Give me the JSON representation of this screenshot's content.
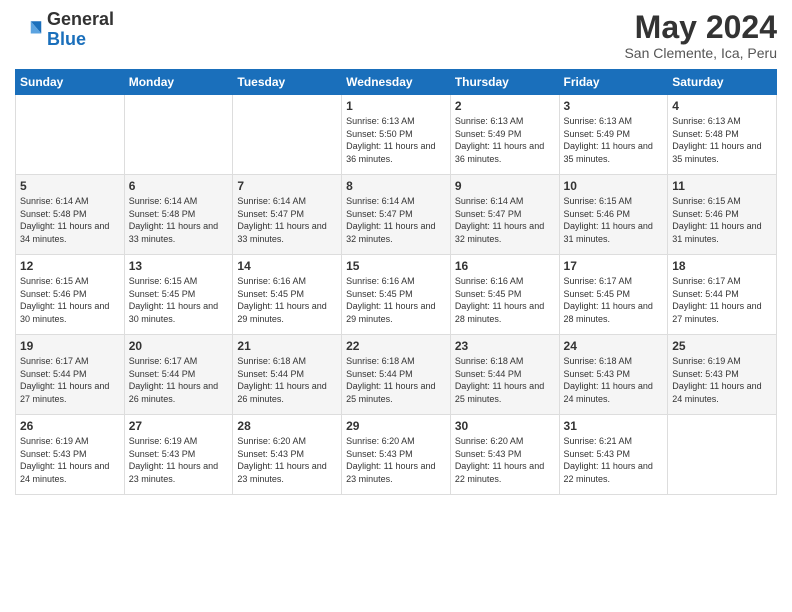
{
  "logo": {
    "general": "General",
    "blue": "Blue"
  },
  "header": {
    "month_title": "May 2024",
    "subtitle": "San Clemente, Ica, Peru"
  },
  "days_of_week": [
    "Sunday",
    "Monday",
    "Tuesday",
    "Wednesday",
    "Thursday",
    "Friday",
    "Saturday"
  ],
  "weeks": [
    [
      {
        "day": "",
        "info": ""
      },
      {
        "day": "",
        "info": ""
      },
      {
        "day": "",
        "info": ""
      },
      {
        "day": "1",
        "info": "Sunrise: 6:13 AM\nSunset: 5:50 PM\nDaylight: 11 hours and 36 minutes."
      },
      {
        "day": "2",
        "info": "Sunrise: 6:13 AM\nSunset: 5:49 PM\nDaylight: 11 hours and 36 minutes."
      },
      {
        "day": "3",
        "info": "Sunrise: 6:13 AM\nSunset: 5:49 PM\nDaylight: 11 hours and 35 minutes."
      },
      {
        "day": "4",
        "info": "Sunrise: 6:13 AM\nSunset: 5:48 PM\nDaylight: 11 hours and 35 minutes."
      }
    ],
    [
      {
        "day": "5",
        "info": "Sunrise: 6:14 AM\nSunset: 5:48 PM\nDaylight: 11 hours and 34 minutes."
      },
      {
        "day": "6",
        "info": "Sunrise: 6:14 AM\nSunset: 5:48 PM\nDaylight: 11 hours and 33 minutes."
      },
      {
        "day": "7",
        "info": "Sunrise: 6:14 AM\nSunset: 5:47 PM\nDaylight: 11 hours and 33 minutes."
      },
      {
        "day": "8",
        "info": "Sunrise: 6:14 AM\nSunset: 5:47 PM\nDaylight: 11 hours and 32 minutes."
      },
      {
        "day": "9",
        "info": "Sunrise: 6:14 AM\nSunset: 5:47 PM\nDaylight: 11 hours and 32 minutes."
      },
      {
        "day": "10",
        "info": "Sunrise: 6:15 AM\nSunset: 5:46 PM\nDaylight: 11 hours and 31 minutes."
      },
      {
        "day": "11",
        "info": "Sunrise: 6:15 AM\nSunset: 5:46 PM\nDaylight: 11 hours and 31 minutes."
      }
    ],
    [
      {
        "day": "12",
        "info": "Sunrise: 6:15 AM\nSunset: 5:46 PM\nDaylight: 11 hours and 30 minutes."
      },
      {
        "day": "13",
        "info": "Sunrise: 6:15 AM\nSunset: 5:45 PM\nDaylight: 11 hours and 30 minutes."
      },
      {
        "day": "14",
        "info": "Sunrise: 6:16 AM\nSunset: 5:45 PM\nDaylight: 11 hours and 29 minutes."
      },
      {
        "day": "15",
        "info": "Sunrise: 6:16 AM\nSunset: 5:45 PM\nDaylight: 11 hours and 29 minutes."
      },
      {
        "day": "16",
        "info": "Sunrise: 6:16 AM\nSunset: 5:45 PM\nDaylight: 11 hours and 28 minutes."
      },
      {
        "day": "17",
        "info": "Sunrise: 6:17 AM\nSunset: 5:45 PM\nDaylight: 11 hours and 28 minutes."
      },
      {
        "day": "18",
        "info": "Sunrise: 6:17 AM\nSunset: 5:44 PM\nDaylight: 11 hours and 27 minutes."
      }
    ],
    [
      {
        "day": "19",
        "info": "Sunrise: 6:17 AM\nSunset: 5:44 PM\nDaylight: 11 hours and 27 minutes."
      },
      {
        "day": "20",
        "info": "Sunrise: 6:17 AM\nSunset: 5:44 PM\nDaylight: 11 hours and 26 minutes."
      },
      {
        "day": "21",
        "info": "Sunrise: 6:18 AM\nSunset: 5:44 PM\nDaylight: 11 hours and 26 minutes."
      },
      {
        "day": "22",
        "info": "Sunrise: 6:18 AM\nSunset: 5:44 PM\nDaylight: 11 hours and 25 minutes."
      },
      {
        "day": "23",
        "info": "Sunrise: 6:18 AM\nSunset: 5:44 PM\nDaylight: 11 hours and 25 minutes."
      },
      {
        "day": "24",
        "info": "Sunrise: 6:18 AM\nSunset: 5:43 PM\nDaylight: 11 hours and 24 minutes."
      },
      {
        "day": "25",
        "info": "Sunrise: 6:19 AM\nSunset: 5:43 PM\nDaylight: 11 hours and 24 minutes."
      }
    ],
    [
      {
        "day": "26",
        "info": "Sunrise: 6:19 AM\nSunset: 5:43 PM\nDaylight: 11 hours and 24 minutes."
      },
      {
        "day": "27",
        "info": "Sunrise: 6:19 AM\nSunset: 5:43 PM\nDaylight: 11 hours and 23 minutes."
      },
      {
        "day": "28",
        "info": "Sunrise: 6:20 AM\nSunset: 5:43 PM\nDaylight: 11 hours and 23 minutes."
      },
      {
        "day": "29",
        "info": "Sunrise: 6:20 AM\nSunset: 5:43 PM\nDaylight: 11 hours and 23 minutes."
      },
      {
        "day": "30",
        "info": "Sunrise: 6:20 AM\nSunset: 5:43 PM\nDaylight: 11 hours and 22 minutes."
      },
      {
        "day": "31",
        "info": "Sunrise: 6:21 AM\nSunset: 5:43 PM\nDaylight: 11 hours and 22 minutes."
      },
      {
        "day": "",
        "info": ""
      }
    ]
  ]
}
